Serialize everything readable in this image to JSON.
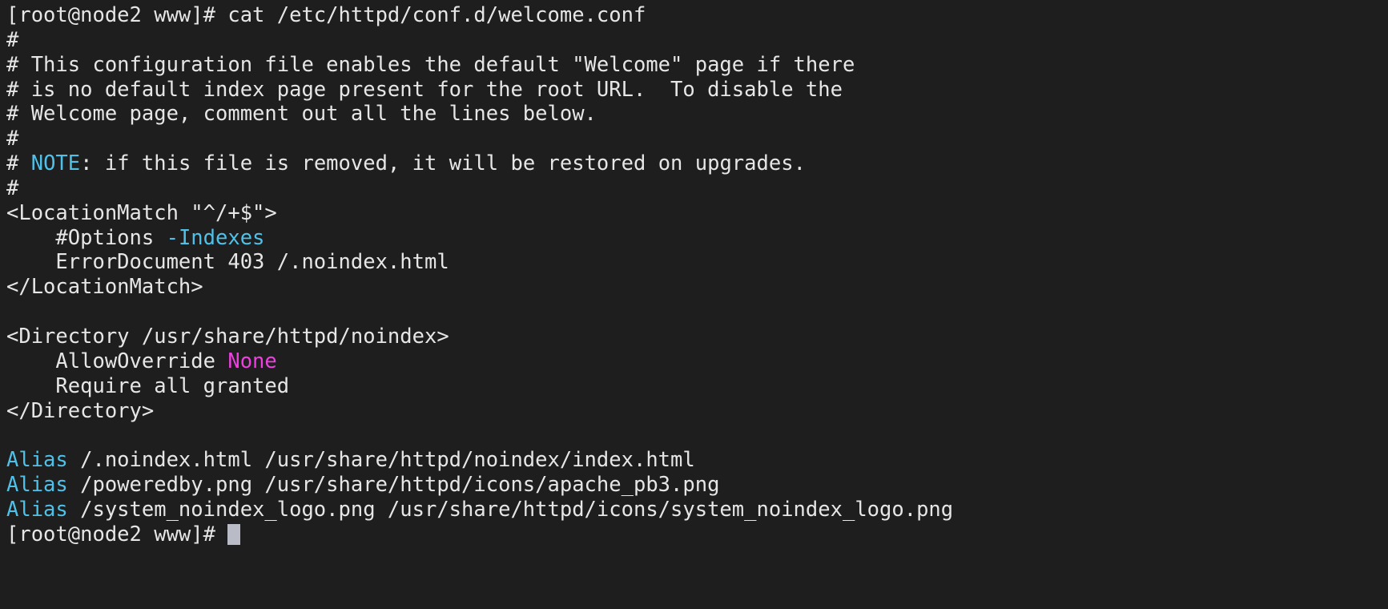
{
  "terminal": {
    "background_color": "#1e1e1e",
    "foreground_color": "#e6e6e6",
    "cyan_color": "#4fc1e9",
    "magenta_color": "#ee40e0",
    "cursor_color": "#b9bcc7",
    "hostname": "node2",
    "user": "root",
    "cwd": "www",
    "prompt": "[root@node2 www]# ",
    "command": "cat /etc/httpd/conf.d/welcome.conf",
    "lines": [
      {
        "id": "line-01-command",
        "segments": [
          {
            "text": "[root@node2 www]# ",
            "color": "default"
          },
          {
            "text": "cat /etc/httpd/conf.d/welcome.conf",
            "color": "default"
          }
        ]
      },
      {
        "id": "line-02-comment",
        "segments": [
          {
            "text": "#",
            "color": "default"
          }
        ]
      },
      {
        "id": "line-03-comment",
        "segments": [
          {
            "text": "# This configuration file enables the default \"Welcome\" page if there",
            "color": "default"
          }
        ]
      },
      {
        "id": "line-04-comment",
        "segments": [
          {
            "text": "# is no default index page present for the root URL.  To disable the",
            "color": "default"
          }
        ]
      },
      {
        "id": "line-05-comment",
        "segments": [
          {
            "text": "# Welcome page, comment out all the lines below.",
            "color": "default"
          }
        ]
      },
      {
        "id": "line-06-comment",
        "segments": [
          {
            "text": "#",
            "color": "default"
          }
        ]
      },
      {
        "id": "line-07-note",
        "segments": [
          {
            "text": "# ",
            "color": "default"
          },
          {
            "text": "NOTE",
            "color": "cyan"
          },
          {
            "text": ": if this file is removed, it will be restored on upgrades.",
            "color": "default"
          }
        ]
      },
      {
        "id": "line-08-comment",
        "segments": [
          {
            "text": "#",
            "color": "default"
          }
        ]
      },
      {
        "id": "line-09-locationmatch-open",
        "segments": [
          {
            "text": "<LocationMatch \"^/+$\">",
            "color": "default"
          }
        ]
      },
      {
        "id": "line-10-options",
        "segments": [
          {
            "text": "    #Options ",
            "color": "default"
          },
          {
            "text": "-Indexes",
            "color": "cyan"
          }
        ]
      },
      {
        "id": "line-11-errordocument",
        "segments": [
          {
            "text": "    ErrorDocument 403 /.noindex.html",
            "color": "default"
          }
        ]
      },
      {
        "id": "line-12-locationmatch-close",
        "segments": [
          {
            "text": "</LocationMatch>",
            "color": "default"
          }
        ]
      },
      {
        "id": "line-13-blank",
        "segments": [
          {
            "text": "",
            "color": "default"
          }
        ]
      },
      {
        "id": "line-14-directory-open",
        "segments": [
          {
            "text": "<Directory /usr/share/httpd/noindex>",
            "color": "default"
          }
        ]
      },
      {
        "id": "line-15-allowoverride",
        "segments": [
          {
            "text": "    AllowOverride ",
            "color": "default"
          },
          {
            "text": "None",
            "color": "magenta"
          }
        ]
      },
      {
        "id": "line-16-require",
        "segments": [
          {
            "text": "    Require all granted",
            "color": "default"
          }
        ]
      },
      {
        "id": "line-17-directory-close",
        "segments": [
          {
            "text": "</Directory>",
            "color": "default"
          }
        ]
      },
      {
        "id": "line-18-blank",
        "segments": [
          {
            "text": "",
            "color": "default"
          }
        ]
      },
      {
        "id": "line-19-alias-noindex",
        "segments": [
          {
            "text": "Alias",
            "color": "cyan"
          },
          {
            "text": " /.noindex.html /usr/share/httpd/noindex/index.html",
            "color": "default"
          }
        ]
      },
      {
        "id": "line-20-alias-poweredby",
        "segments": [
          {
            "text": "Alias",
            "color": "cyan"
          },
          {
            "text": " /poweredby.png /usr/share/httpd/icons/apache_pb3.png",
            "color": "default"
          }
        ]
      },
      {
        "id": "line-21-alias-logo",
        "segments": [
          {
            "text": "Alias",
            "color": "cyan"
          },
          {
            "text": " /system_noindex_logo.png /usr/share/httpd/icons/system_noindex_logo.png",
            "color": "default"
          }
        ]
      },
      {
        "id": "line-22-prompt",
        "segments": [
          {
            "text": "[root@node2 www]# ",
            "color": "default"
          }
        ],
        "cursor": true
      }
    ]
  }
}
